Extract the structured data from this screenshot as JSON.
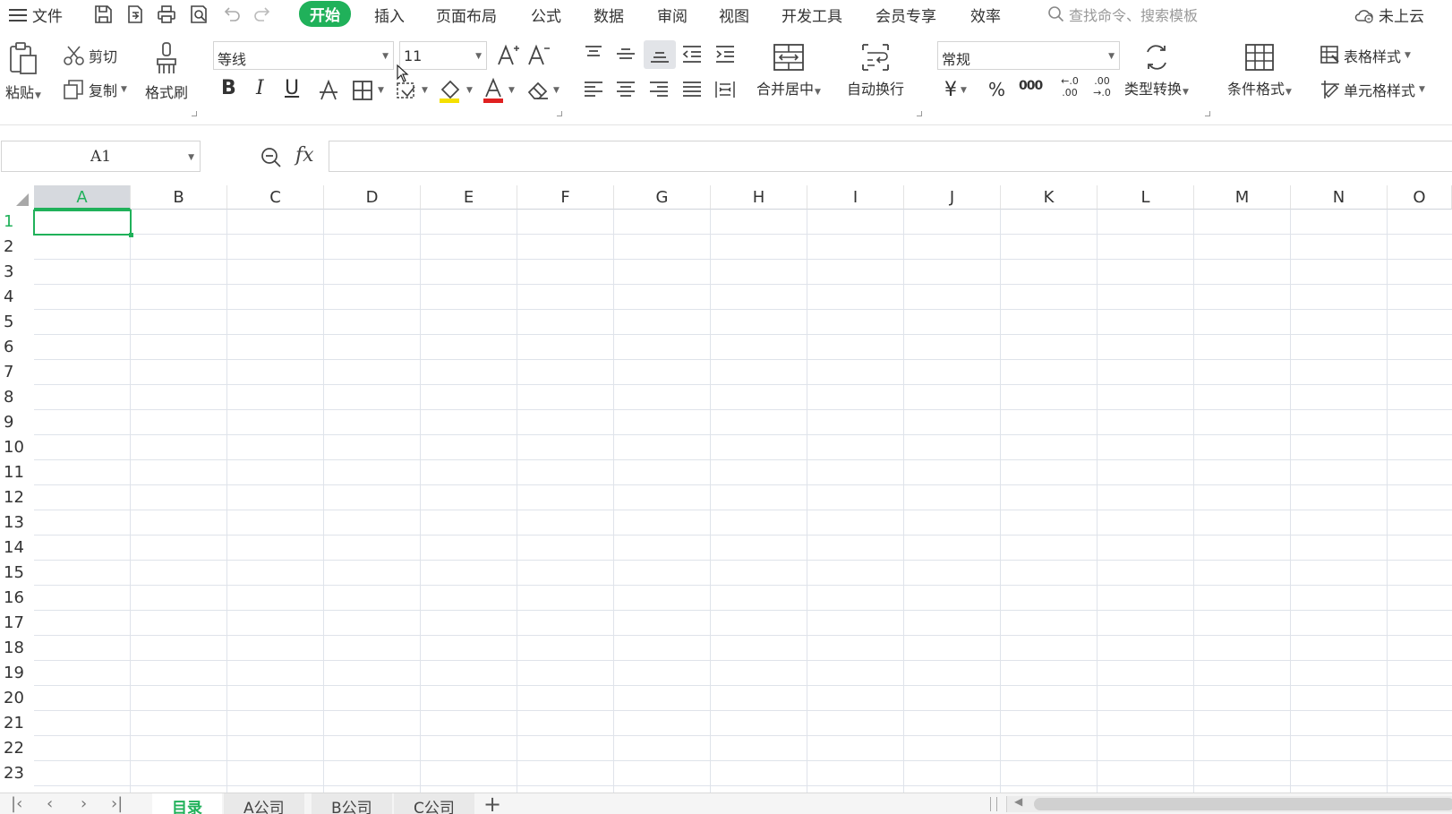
{
  "menu": {
    "file_label": "文件",
    "tabs": [
      {
        "label": "开始",
        "active": true
      },
      {
        "label": "插入"
      },
      {
        "label": "页面布局"
      },
      {
        "label": "公式"
      },
      {
        "label": "数据"
      },
      {
        "label": "审阅"
      },
      {
        "label": "视图"
      },
      {
        "label": "开发工具"
      },
      {
        "label": "会员专享"
      },
      {
        "label": "效率"
      }
    ],
    "search_placeholder": "查找命令、搜索模板",
    "cloud_label": "未上云"
  },
  "ribbon": {
    "paste": "粘贴",
    "cut": "剪切",
    "copy": "复制",
    "format_painter": "格式刷",
    "font_name": "等线",
    "font_size": "11",
    "merge_center": "合并居中",
    "wrap_text": "自动换行",
    "number_format": "常规",
    "type_convert": "类型转换",
    "conditional_format": "条件格式",
    "table_style": "表格样式",
    "cell_style": "单元格样式",
    "bold": "B",
    "italic": "I",
    "underline": "U",
    "currency": "¥",
    "percent": "%",
    "thousands": "000",
    "inc_decimal": "←.0 .00",
    "dec_decimal": ".00 →.0"
  },
  "formula_bar": {
    "name_box": "A1",
    "fx": "fx",
    "formula": ""
  },
  "grid": {
    "columns": [
      "A",
      "B",
      "C",
      "D",
      "E",
      "F",
      "G",
      "H",
      "I",
      "J",
      "K",
      "L",
      "M",
      "N",
      "O"
    ],
    "rows": [
      "1",
      "2",
      "3",
      "4",
      "5",
      "6",
      "7",
      "8",
      "9",
      "10",
      "11",
      "12",
      "13",
      "14",
      "15",
      "16",
      "17",
      "18",
      "19",
      "20",
      "21",
      "22",
      "23"
    ],
    "selected_cell": "A1"
  },
  "sheets": {
    "tabs": [
      {
        "label": "目录",
        "active": true
      },
      {
        "label": "A公司"
      },
      {
        "label": "B公司"
      },
      {
        "label": "C公司"
      }
    ],
    "add": "+"
  },
  "colors": {
    "accent": "#20b15a",
    "gridline": "#dfe3ea",
    "font_color_bar": "#e02020",
    "fill_color_bar": "#f5e000"
  }
}
